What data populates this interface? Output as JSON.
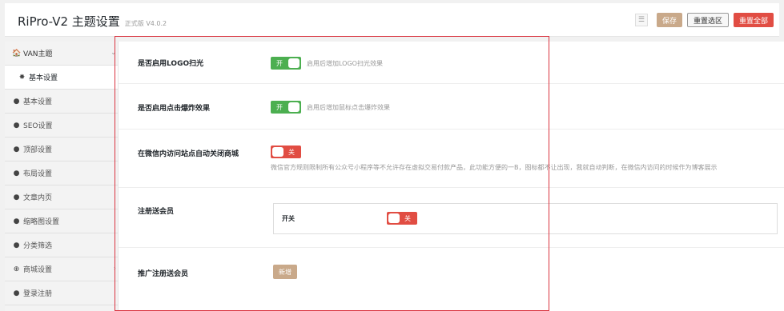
{
  "header": {
    "title": "RiPro-V2 主题设置",
    "version": "正式版 V4.0.2",
    "icon_glyph": "☰",
    "save_label": "保存",
    "reset_section_label": "重置选区",
    "reset_all_label": "重置全部"
  },
  "sidebar": {
    "items": [
      {
        "label": "VAN主题",
        "icon": "home-icon",
        "glyph": "🏠"
      },
      {
        "label": "基本设置",
        "icon": "gear-icon",
        "glyph": "✸"
      },
      {
        "label": "基本设置",
        "icon": "dot-icon",
        "glyph": "●"
      },
      {
        "label": "SEO设置",
        "icon": "dot-icon",
        "glyph": "●"
      },
      {
        "label": "顶部设置",
        "icon": "dot-icon",
        "glyph": "●"
      },
      {
        "label": "布局设置",
        "icon": "dot-icon",
        "glyph": "●"
      },
      {
        "label": "文章内页",
        "icon": "dot-icon",
        "glyph": "●"
      },
      {
        "label": "缩略图设置",
        "icon": "dot-icon",
        "glyph": "●"
      },
      {
        "label": "分类筛选",
        "icon": "dot-icon",
        "glyph": "●"
      },
      {
        "label": "商城设置",
        "icon": "plus-circle-icon",
        "glyph": "⊕"
      },
      {
        "label": "登录注册",
        "icon": "dot-icon",
        "glyph": "●"
      }
    ],
    "arrow_down": "⌄",
    "arrow_right": "›"
  },
  "settings": [
    {
      "label": "是否启用LOGO扫光",
      "toggle": "开",
      "state": "on",
      "desc": "启用后增加LOGO扫光效果"
    },
    {
      "label": "是否启用点击爆炸效果",
      "toggle": "开",
      "state": "on",
      "desc": "启用后增加鼠标点击爆炸效果"
    },
    {
      "label": "在微信内访问站点自动关闭商城",
      "toggle": "关",
      "state": "off",
      "desc": "微信官方规则限制所有公众号小程序等不允许存在虚拟交易付款产品，此功能方便的一B，图标都不让出现，我就自动判断，在微信内访问的时候作为博客展示"
    },
    {
      "label": "注册送会员",
      "sub_label": "开关",
      "toggle": "关",
      "state": "off"
    },
    {
      "label": "推广注册送会员",
      "button": "新增"
    }
  ],
  "colors": {
    "toggle_on": "#4caf50",
    "toggle_off": "#e14d43",
    "accent": "#c9a98a",
    "highlight_border": "#d9333f"
  }
}
